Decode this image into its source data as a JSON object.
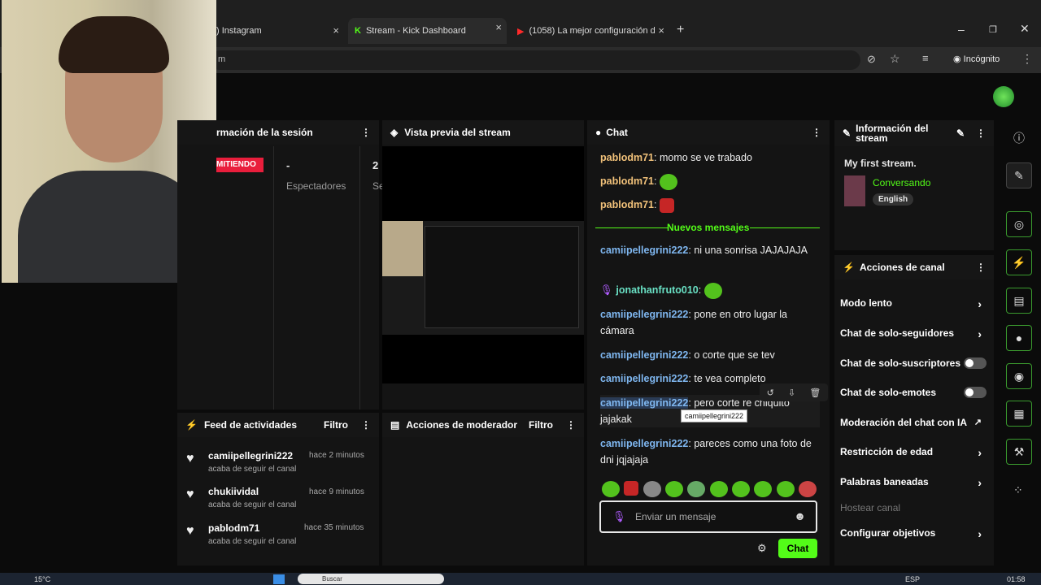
{
  "browser": {
    "tabs": [
      {
        "label": ") Instagram"
      },
      {
        "label": "Stream - Kick Dashboard"
      },
      {
        "label": "(1058) La mejor configuración d"
      }
    ],
    "new_tab": "+",
    "url_fragment": "m",
    "incognito": "Incógnito"
  },
  "session_panel": {
    "title": "rmación de la sesión",
    "status": "MITIENDO",
    "viewers_value": "-",
    "viewers_label": "Espectadores",
    "col2_value": "2",
    "col2_label": "Se"
  },
  "preview_panel": {
    "title": "Vista previa del stream"
  },
  "chat_panel": {
    "title": "Chat",
    "new_messages": "Nuevos mensajes",
    "messages": [
      {
        "user": "pablodm71",
        "text": "momo se ve trabado"
      },
      {
        "user": "pablodm71",
        "text": ""
      },
      {
        "user": "pablodm71",
        "text": ""
      },
      {
        "user": "camiipellegrini222",
        "text": "ni una sonrisa JAJAJAJA"
      },
      {
        "user": "jonathanfruto010",
        "text": ""
      },
      {
        "user": "camiipellegrini222",
        "text": "pone en otro lugar la cámara"
      },
      {
        "user": "camiipellegrini222",
        "text": "o corte que se tev"
      },
      {
        "user": "camiipellegrini222",
        "text": "te vea completo"
      },
      {
        "user": "camiipellegrini222",
        "text": "pero corte re chiquito jajakak"
      },
      {
        "user": "camiipellegrini222",
        "text": "pareces como una foto de dni jqjajaja"
      }
    ],
    "tooltip": "camiipellegrini222",
    "input_placeholder": "Enviar un mensaje",
    "send_label": "Chat"
  },
  "stream_info": {
    "title": "Información del stream",
    "stream_title": "My first stream.",
    "category": "Conversando",
    "language": "English"
  },
  "channel_actions": {
    "title": "Acciones de canal",
    "items": [
      {
        "label": "Modo lento"
      },
      {
        "label": "Chat de solo-seguidores"
      },
      {
        "label": "Chat de solo-suscriptores"
      },
      {
        "label": "Chat de solo-emotes"
      },
      {
        "label": "Moderación del chat con IA"
      },
      {
        "label": "Restricción de edad"
      },
      {
        "label": "Palabras baneadas"
      },
      {
        "label": "Hostear canal"
      },
      {
        "label": "Configurar objetivos"
      }
    ]
  },
  "activity_feed": {
    "title": "Feed de actividades",
    "filter": "Filtro",
    "items": [
      {
        "user": "camiipellegrini222",
        "time": "hace 2 minutos",
        "action": "acaba de seguir el canal"
      },
      {
        "user": "chukiividal",
        "time": "hace 9 minutos",
        "action": "acaba de seguir el canal"
      },
      {
        "user": "pablodm71",
        "time": "hace 35 minutos",
        "action": "acaba de seguir el canal"
      }
    ]
  },
  "mod_actions": {
    "title": "Acciones de moderador",
    "filter": "Filtro"
  },
  "taskbar": {
    "temperature": "15°C",
    "lang": "ESP",
    "time": "01:58",
    "search": "Buscar"
  },
  "colors": {
    "accent": "#53fc18",
    "live": "#e91e3c"
  }
}
